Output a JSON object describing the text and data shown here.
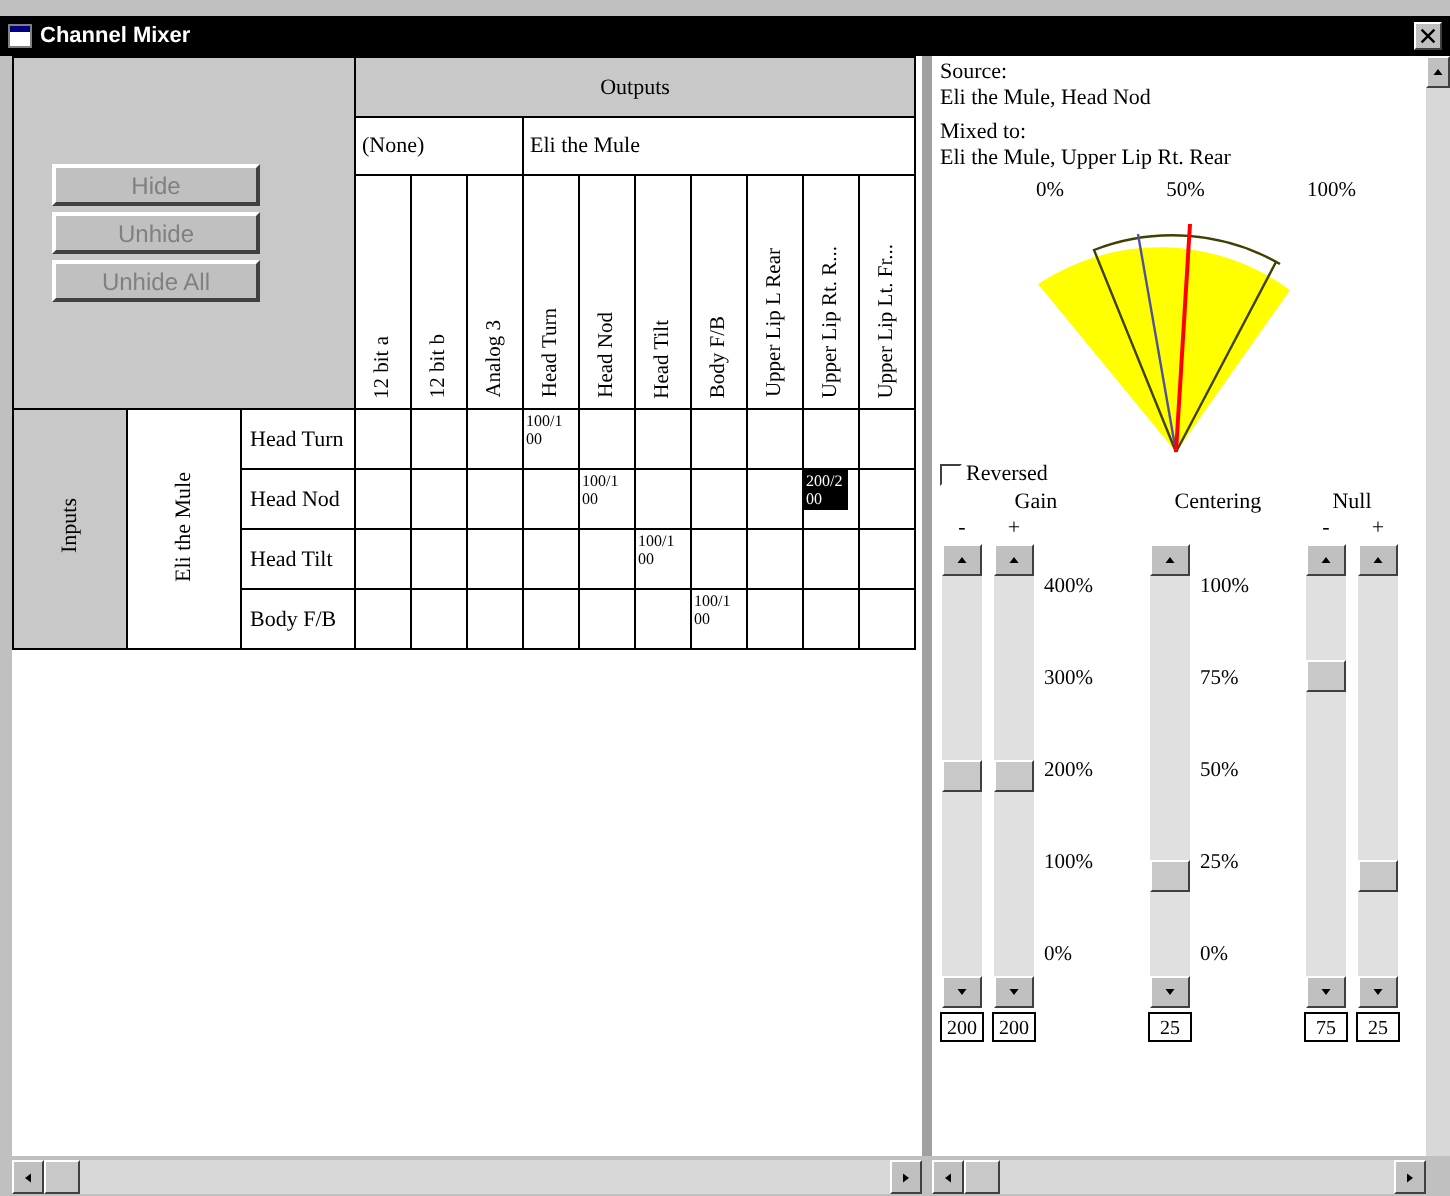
{
  "window": {
    "title": "Channel Mixer"
  },
  "buttons": [
    {
      "label": "Hide",
      "disabled": true
    },
    {
      "label": "Unhide",
      "disabled": true
    },
    {
      "label": "Unhide All",
      "disabled": true
    }
  ],
  "outputs": {
    "title": "Outputs",
    "groups": [
      {
        "label": "(None)",
        "columns": [
          "12 bit a",
          "12 bit b",
          "Analog 3"
        ]
      },
      {
        "label": "Eli the Mule",
        "columns": [
          "Head Turn",
          "Head Nod",
          "Head Tilt",
          "Body F/B",
          "Upper Lip L Rear",
          "Upper Lip Rt. R...",
          "Upper Lip Lt. Fr..."
        ]
      }
    ]
  },
  "inputs": {
    "title": "Inputs",
    "groups": [
      {
        "label": "Eli the Mule",
        "rows": [
          {
            "name": "Head Turn",
            "cells": [
              null,
              null,
              null,
              {
                "value": "100/100",
                "selected": false
              },
              null,
              null,
              null,
              null,
              null,
              null
            ]
          },
          {
            "name": "Head Nod",
            "cells": [
              null,
              null,
              null,
              null,
              {
                "value": "100/100",
                "selected": false
              },
              null,
              null,
              null,
              {
                "value": "200/200",
                "selected": true
              },
              null
            ]
          },
          {
            "name": "Head Tilt",
            "cells": [
              null,
              null,
              null,
              null,
              null,
              {
                "value": "100/100",
                "selected": false
              },
              null,
              null,
              null,
              null
            ]
          },
          {
            "name": "Body F/B",
            "cells": [
              null,
              null,
              null,
              null,
              null,
              null,
              {
                "value": "100/100",
                "selected": false
              },
              null,
              null,
              null
            ]
          }
        ]
      }
    ]
  },
  "details": {
    "source_label": "Source:",
    "source": "Eli the Mule, Head Nod",
    "mixed_label": "Mixed to:",
    "mixed": "Eli the Mule, Upper Lip Rt. Rear",
    "gauge": {
      "labels": [
        "0%",
        "50%",
        "100%"
      ]
    },
    "reversed": {
      "label": "Reversed",
      "checked": false
    },
    "groups": [
      {
        "label": "Gain",
        "scale": [
          "400%",
          "300%",
          "200%",
          "100%",
          "0%"
        ],
        "sliders": [
          {
            "label": "-",
            "level": 0.5,
            "value": "200"
          },
          {
            "label": "+",
            "level": 0.5,
            "value": "200"
          }
        ]
      },
      {
        "label": "Centering",
        "scale": [
          "100%",
          "75%",
          "50%",
          "25%",
          "0%"
        ],
        "sliders": [
          {
            "level": 0.25,
            "value": "25"
          }
        ]
      },
      {
        "label": "Null",
        "sliders": [
          {
            "label": "-",
            "level": 0.75,
            "value": "75"
          },
          {
            "label": "+",
            "level": 0.25,
            "value": "25"
          }
        ]
      }
    ]
  }
}
